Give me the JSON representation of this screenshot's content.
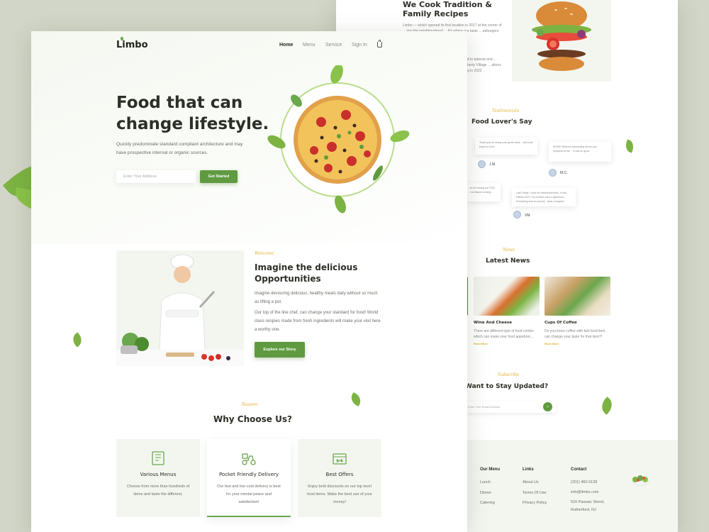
{
  "brand": "Limbo",
  "nav": {
    "items": [
      "Home",
      "Menu",
      "Service",
      "Sign In"
    ],
    "active": "Home"
  },
  "hero": {
    "title_line1": "Food that can",
    "title_line2": "change lifestyle.",
    "subtitle": "Quickly predominate standard compliant architecture and may have prospective internal or organic sources.",
    "address_placeholder": "Enter Your Address",
    "cta": "Get Started"
  },
  "welcome": {
    "tag": "Welcome",
    "title_line1": "Imagine the delicious",
    "title_line2": "Opportunities",
    "para1": "Imagine devouring delicious, healthy meals daily without so much as lifting a pot.",
    "para2": "Our top of the line chef, can change your standard for food! World class recipies made from fresh ingredients will make your visit here a worthy one.",
    "cta": "Explore our Story"
  },
  "reason": {
    "tag": "Reason",
    "title": "Why Choose Us?",
    "cards": [
      {
        "title": "Various Menus",
        "text": "Choose from more than hundreds of items and taste the different."
      },
      {
        "title": "Pocket Friendly Delivery",
        "text": "Our fast and low cost delivery is best for your mental peace and satisfaction!"
      },
      {
        "title": "Best Offers",
        "text": "Enjoy bold discounts on our top level food items. Make the best use of your money!"
      }
    ]
  },
  "tradition": {
    "title_line1": "We Cook Tradition &",
    "title_line2": "Family Recipes",
    "text1": "Limbo — which opened its first location in 2017 at the corner of ... into the neighbourhood ... It's where our taste ... eeburgers and lemon",
    "text2": "ncluded to takeout and ... ears Liberty Village ... ations opening in 2022"
  },
  "testimonials": {
    "tag": "Testimonials",
    "title": "Food Lover's Say",
    "reviews": [
      {
        "text": "Thank you for being such great value... will come back for more.",
        "name": "J.M."
      },
      {
        "text": "WOW!! What an outstanding dinner you prepared at the ... it was so good.",
        "name": "M.C."
      },
      {
        "text": "...ks for having our TOO! ... eat flavors coming ...",
        "name": ""
      },
      {
        "text": "Last Friday I came for restaurant week. It was FABULOUS! The portions were a generous... Everything was so yummy - what a bargain!",
        "name": "VM"
      }
    ]
  },
  "news": {
    "tag": "News",
    "title": "Latest News",
    "items": [
      {
        "title": "Wine And Cheese",
        "text": "There are different type of food combo which can make your food appetizer...",
        "link": "Read More"
      },
      {
        "title": "Cups Of Coffee",
        "text": "Do you know coffee with fast food item can change your taste for that item?!",
        "link": "Read More"
      }
    ]
  },
  "subscribe": {
    "tag": "Subscribe",
    "title": "Want to Stay Updated?",
    "placeholder": "Enter Your Email Address"
  },
  "footer": {
    "menu_title": "Our Menu",
    "menu": [
      "Lunch",
      "Dinner",
      "Catering"
    ],
    "links_title": "Links",
    "links": [
      "About Us",
      "Terms Of Use",
      "Privacy Policy"
    ],
    "contact_title": "Contact",
    "phone": "(201) 460 0139",
    "email": "info@limbo.com",
    "address_line1": "516 Passaic Street,",
    "address_line2": "Rutherford, NJ"
  },
  "colors": {
    "accent": "#5f9a40",
    "gold": "#e0b431",
    "backdrop": "#d2d6c8",
    "dark": "#1f2219"
  }
}
